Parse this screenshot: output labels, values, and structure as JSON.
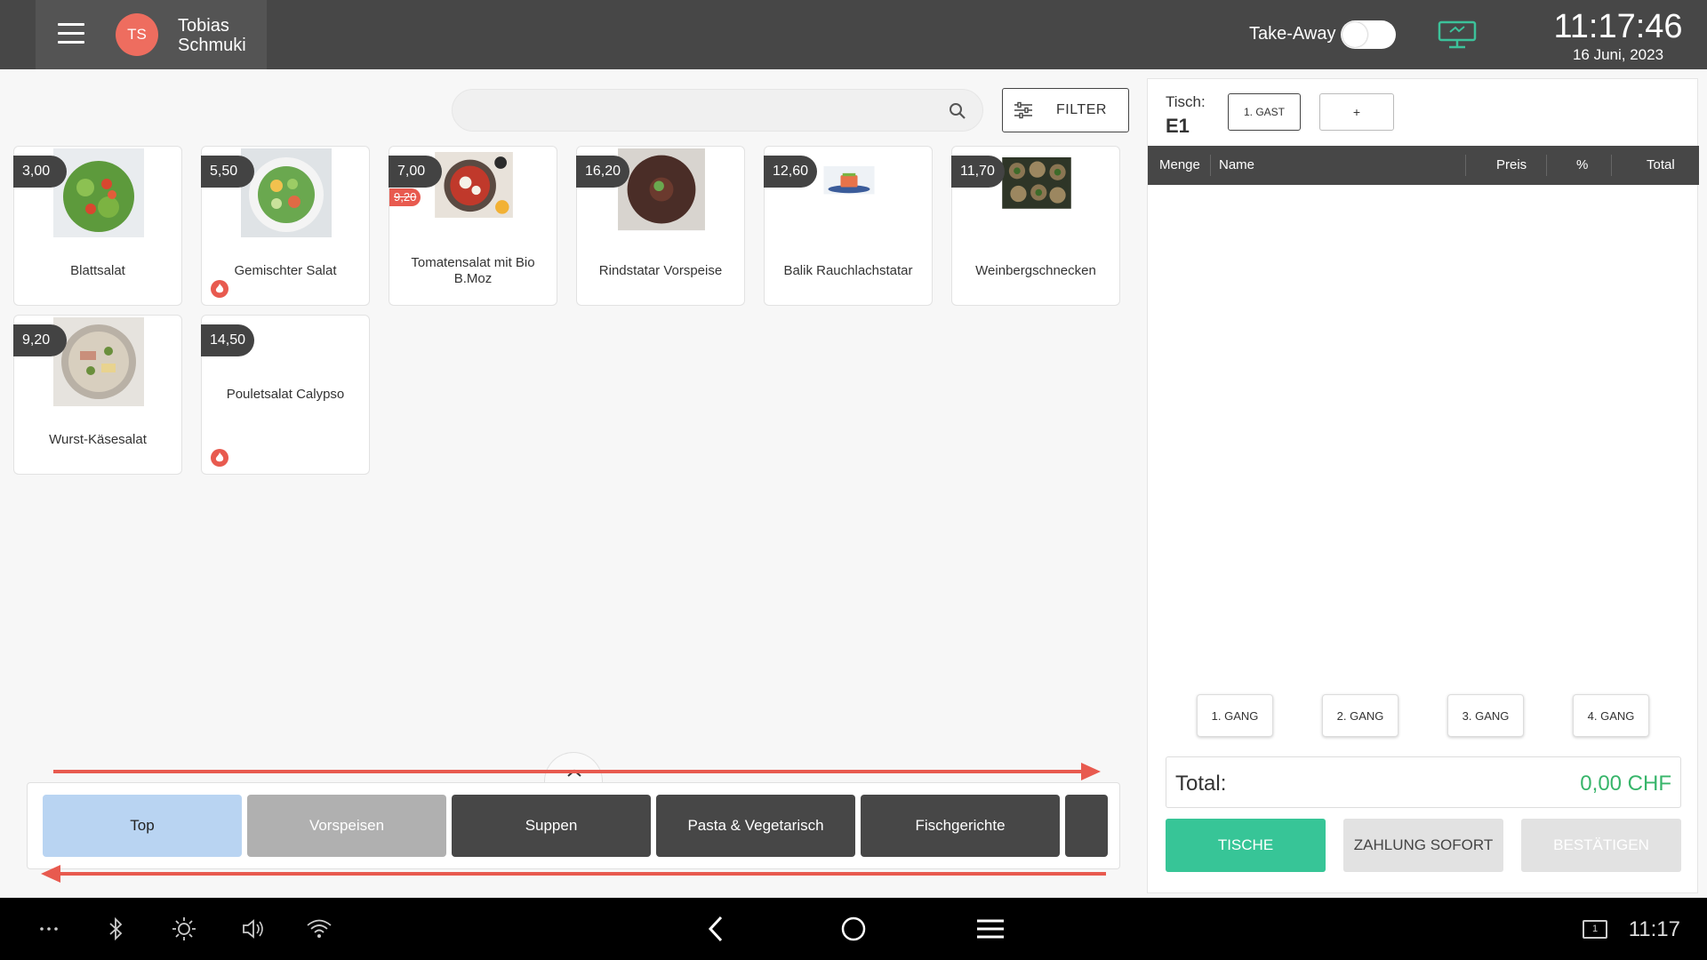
{
  "header": {
    "menu_icon": "hamburger-icon",
    "user_initials": "TS",
    "user_name": "Tobias Schmuki",
    "takeaway_label": "Take-Away",
    "takeaway_on": false,
    "display_icon": "customer-display-icon",
    "time": "11:17:46",
    "date": "16 Juni, 2023"
  },
  "search": {
    "placeholder": "",
    "icon": "search-icon"
  },
  "filter": {
    "label": "FILTER",
    "icon": "sliders-icon"
  },
  "products": [
    {
      "name": "Blattsalat",
      "price": "3,00",
      "old_price": "",
      "hot": false
    },
    {
      "name": "Gemischter Salat",
      "price": "5,50",
      "old_price": "",
      "hot": true
    },
    {
      "name": "Tomatensalat mit Bio B.Moz",
      "price": "7,00",
      "old_price": "9,20",
      "hot": false
    },
    {
      "name": "Rindstatar Vorspeise",
      "price": "16,20",
      "old_price": "",
      "hot": false
    },
    {
      "name": "Balik Rauchlachstatar",
      "price": "12,60",
      "old_price": "",
      "hot": false
    },
    {
      "name": "Weinbergschnecken",
      "price": "11,70",
      "old_price": "",
      "hot": false
    },
    {
      "name": "Wurst-Käsesalat",
      "price": "9,20",
      "old_price": "",
      "hot": false
    },
    {
      "name": "Pouletsalat Calypso",
      "price": "14,50",
      "old_price": "",
      "hot": true
    }
  ],
  "categories": [
    "Top",
    "Vorspeisen",
    "Suppen",
    "Pasta & Vegetarisch",
    "Fischgerichte"
  ],
  "order": {
    "table_label": "Tisch:",
    "table_value": "E1",
    "guest_button": "1. GAST",
    "add_button": "+",
    "columns": [
      "Menge",
      "Name",
      "Preis",
      "%",
      "Total"
    ],
    "courses": [
      "1. GANG",
      "2. GANG",
      "3. GANG",
      "4. GANG"
    ],
    "total_label": "Total:",
    "total_value": "0,00 CHF",
    "buttons": {
      "tables": "TISCHE",
      "pay_now": "ZAHLUNG SOFORT",
      "confirm": "BESTÄTIGEN"
    }
  },
  "navbar": {
    "time": "11:17",
    "keyboard_label": "1"
  },
  "colors": {
    "header_bg": "#474747",
    "accent_red": "#e85a4f",
    "accent_green": "#37c597",
    "total_green": "#37b56a",
    "active_category": "#b9d4f2"
  }
}
